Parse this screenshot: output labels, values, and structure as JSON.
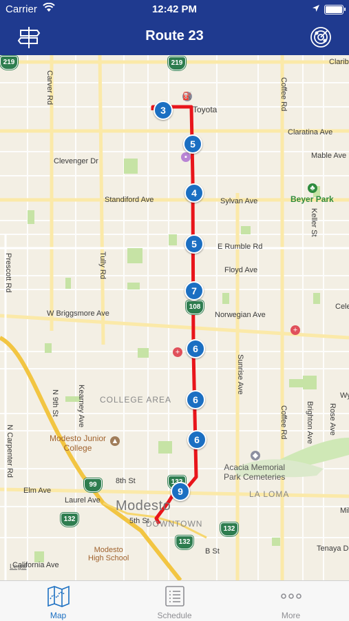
{
  "status": {
    "carrier": "Carrier",
    "time": "12:42 PM"
  },
  "nav": {
    "title": "Route 23",
    "left_icon": "signpost-icon",
    "right_icon": "radar-globe-icon"
  },
  "map": {
    "streets": {
      "claribel": "Claribe",
      "carver": "Carver Rd",
      "coffee_top": "Coffee Rd",
      "claratina": "Claratina Ave",
      "mable": "Mable Ave",
      "clevenger": "Clevenger Dr",
      "standiford": "Standiford Ave",
      "sylvan": "Sylvan Ave",
      "keller": "Keller St",
      "rumble": "E Rumble Rd",
      "prescott": "Prescott Rd",
      "tully": "Tully Rd",
      "floyd": "Floyd Ave",
      "briggsmore": "W Briggsmore Ave",
      "norwegian": "Norwegian Ave",
      "cele": "Cele",
      "sunrise": "Sunrise Ave",
      "n9th": "N 9th St",
      "kearney": "Kearney Ave",
      "wy": "Wy",
      "coffee_bottom": "Coffee Rd",
      "brighton": "Brighton Ave",
      "rose": "Rose Ave",
      "ncarpenter": "N Carpenter Rd",
      "eighth": "8th St",
      "elm": "Elm Ave",
      "laurel": "Laurel Ave",
      "fifth": "5th St",
      "mil": "Mil",
      "tenaya": "Tenaya D",
      "bst": "B St",
      "california": "California Ave"
    },
    "places": {
      "toyota": "Toyota",
      "beyer": "Beyer Park",
      "college_area": "COLLEGE AREA",
      "mjc": "Modesto Junior\nCollege",
      "acacia": "Acacia Memorial\nPark Cemeteries",
      "laloma": "LA LOMA",
      "modesto": "Modesto",
      "downtown": "DOWNTOWN",
      "mhs": "Modesto\nHigh School",
      "legal": "Legal"
    },
    "shields": [
      "219",
      "219",
      "108",
      "99",
      "132",
      "132",
      "132",
      "132"
    ],
    "stops": [
      "3",
      "5",
      "4",
      "5",
      "7",
      "6",
      "6",
      "6",
      "9"
    ],
    "route_color": "#e8151b",
    "stop_color": "#1b6fc2"
  },
  "tabs": [
    {
      "label": "Map",
      "icon": "map-icon",
      "active": true
    },
    {
      "label": "Schedule",
      "icon": "schedule-icon",
      "active": false
    },
    {
      "label": "More",
      "icon": "more-icon",
      "active": false
    }
  ],
  "colors": {
    "bar": "#1f3a8f",
    "tab_active": "#1b6fc2",
    "tab_inactive": "#8e8e93"
  }
}
